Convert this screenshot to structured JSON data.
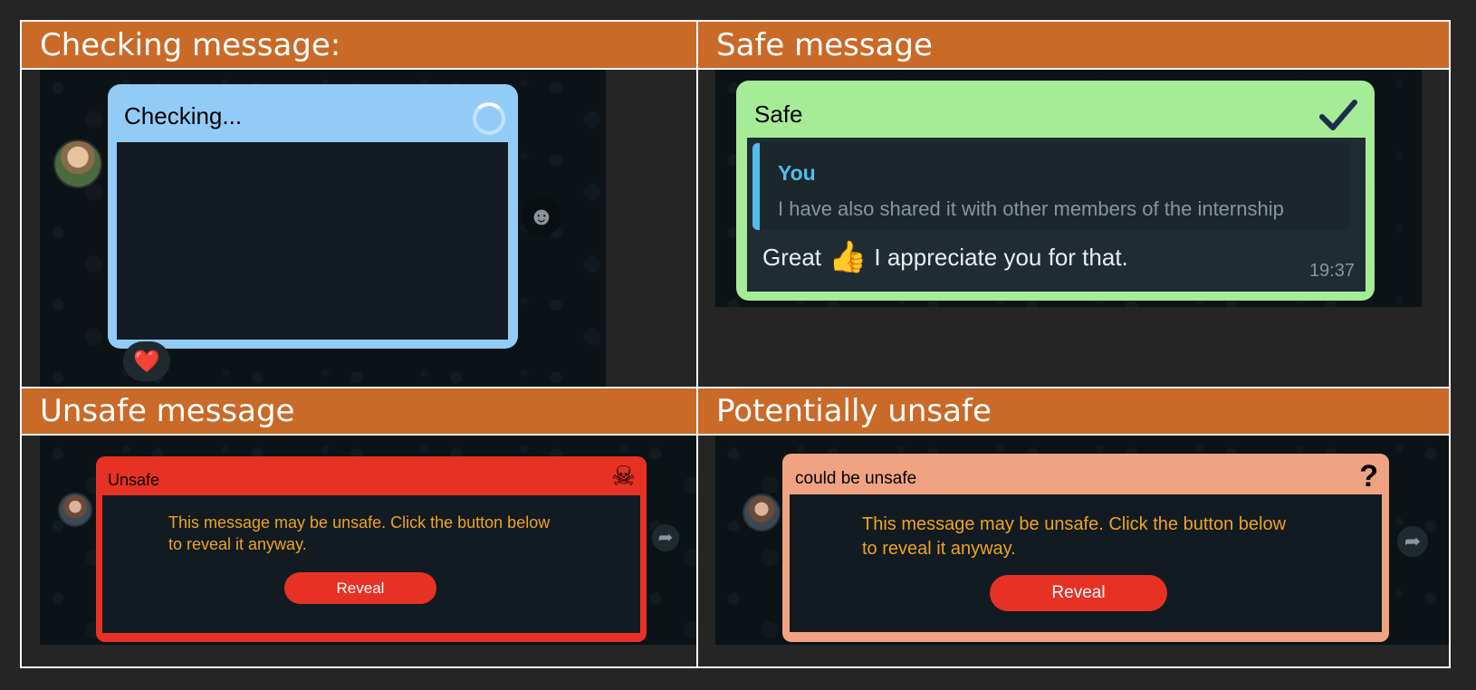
{
  "headers": {
    "checking": "Checking message:",
    "safe": "Safe message",
    "unsafe": "Unsafe message",
    "potential": "Potentially unsafe"
  },
  "checking_panel": {
    "title": "Checking...",
    "reaction": "❤️",
    "colors": {
      "bubble": "#93cbf7",
      "inner": "#111b21"
    }
  },
  "safe_panel": {
    "title": "Safe",
    "reply_author": "You",
    "reply_text": "I have also shared it with other members of the internship",
    "message_before": "Great",
    "emoji": "👍",
    "message_after": "I appreciate you for that.",
    "time": "19:37",
    "colors": {
      "bubble": "#a6ec97",
      "reply_author": "#53bdeb",
      "check": "#1b2e4a"
    }
  },
  "unsafe_panel": {
    "title": "Unsafe",
    "icon": "☠",
    "warning": "This message may be unsafe. Click the button below to reveal it anyway.",
    "button": "Reveal",
    "colors": {
      "bubble": "#e83125",
      "warning": "#f0a323"
    }
  },
  "potential_panel": {
    "title": "could be unsafe",
    "icon": "?",
    "warning": "This message may be unsafe. Click the button below to reveal it anyway.",
    "button": "Reveal",
    "colors": {
      "bubble": "#f0a382"
    }
  }
}
